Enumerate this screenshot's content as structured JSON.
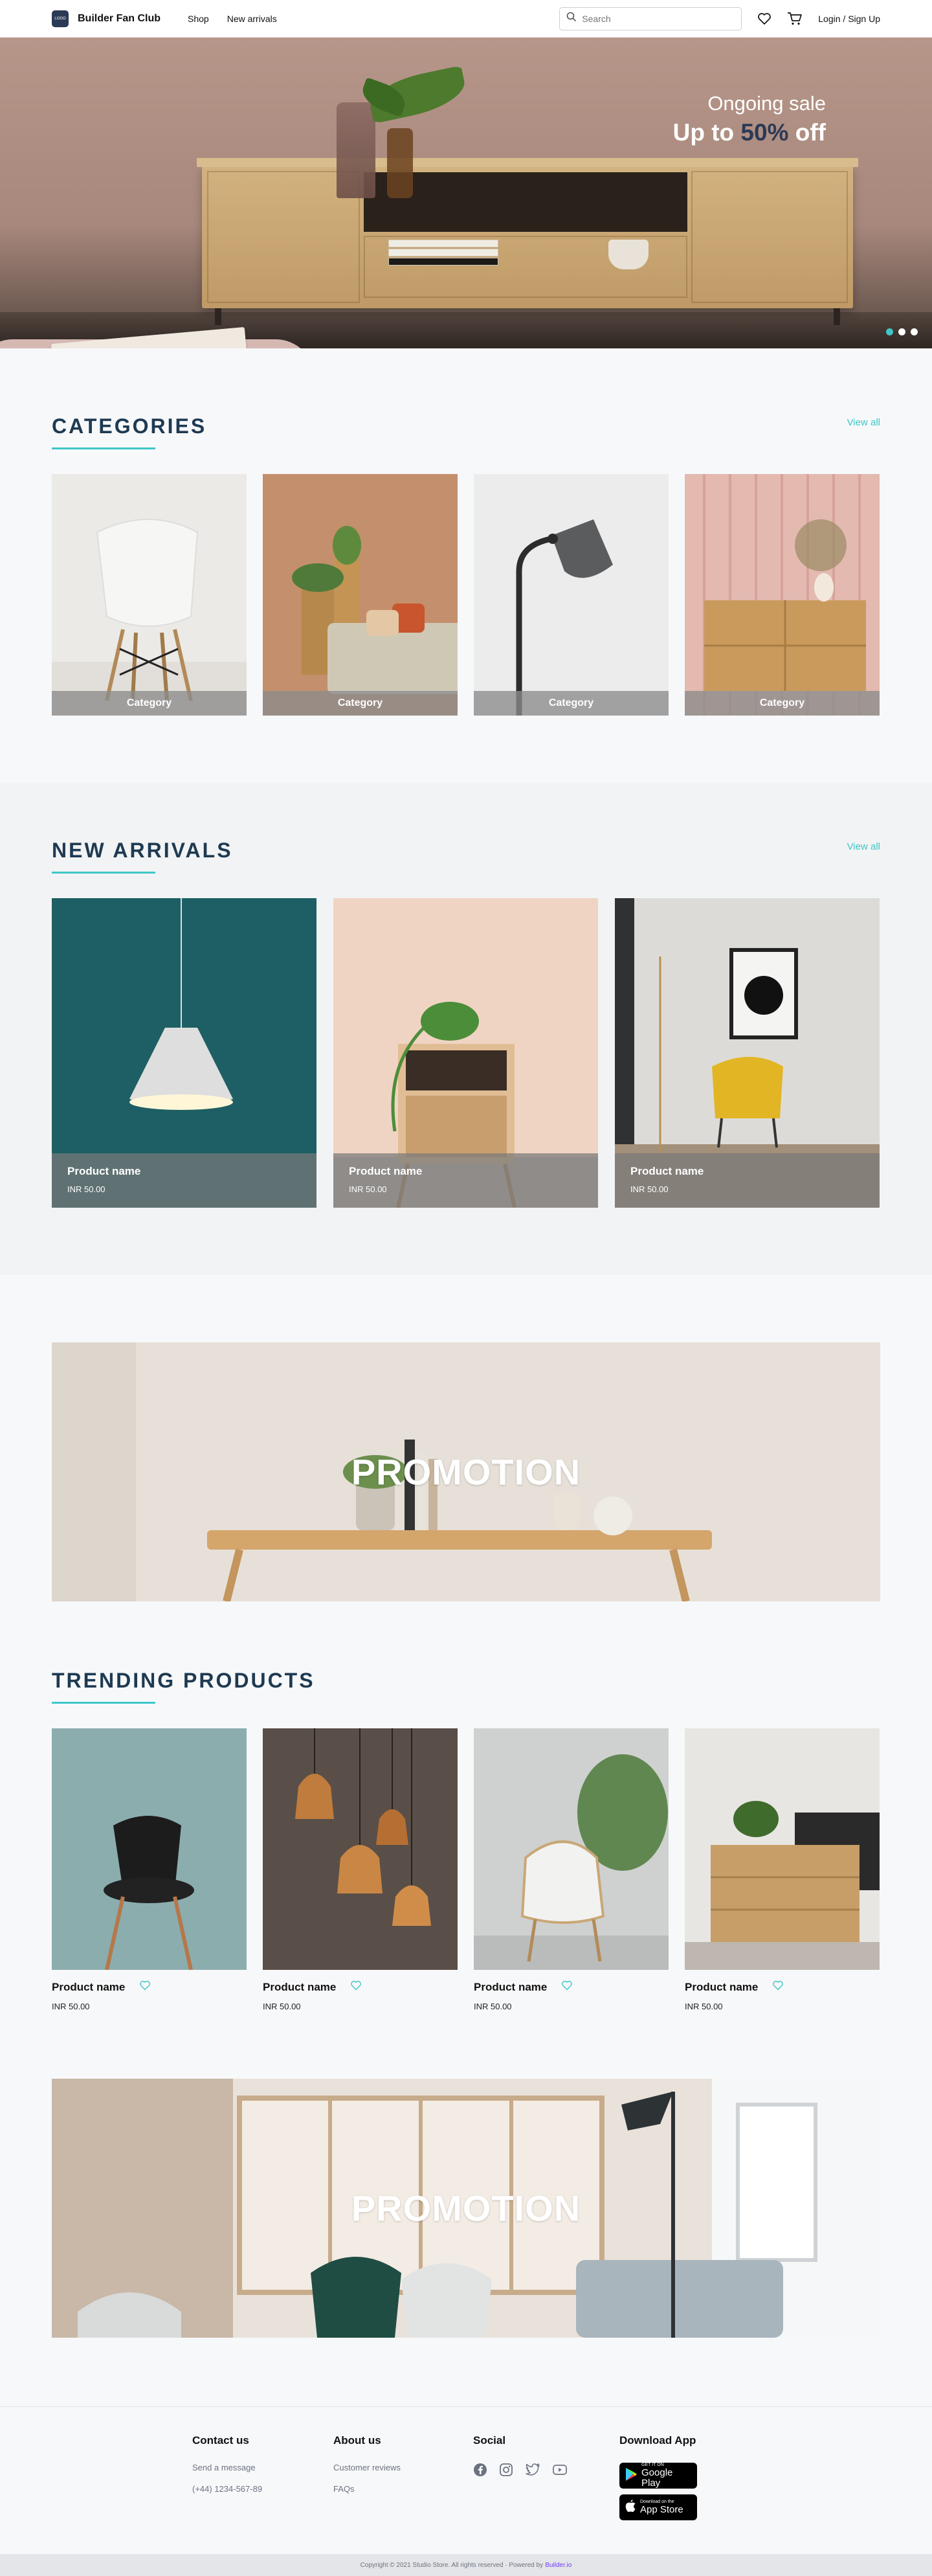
{
  "header": {
    "logo_text": "LOGO",
    "brand": "Builder Fan Club",
    "nav": [
      "Shop",
      "New arrivals"
    ],
    "search_placeholder": "Search",
    "login": "Login / Sign Up"
  },
  "hero": {
    "subtitle": "Ongoing sale",
    "title_prefix": "Up to",
    "title_percent": "50%",
    "title_suffix": "off",
    "dots": 3,
    "active_dot": 0
  },
  "categories": {
    "title": "CATEGORIES",
    "view_all": "View all",
    "items": [
      {
        "label": "Category"
      },
      {
        "label": "Category"
      },
      {
        "label": "Category"
      },
      {
        "label": "Category"
      }
    ]
  },
  "new_arrivals": {
    "title": "NEW ARRIVALS",
    "view_all": "View all",
    "items": [
      {
        "name": "Product name",
        "price": "INR 50.00"
      },
      {
        "name": "Product name",
        "price": "INR 50.00"
      },
      {
        "name": "Product name",
        "price": "INR 50.00"
      }
    ]
  },
  "promo1": {
    "text": "PROMOTION"
  },
  "trending": {
    "title": "TRENDING PRODUCTS",
    "items": [
      {
        "name": "Product name",
        "price": "INR 50.00"
      },
      {
        "name": "Product name",
        "price": "INR 50.00"
      },
      {
        "name": "Product name",
        "price": "INR 50.00"
      },
      {
        "name": "Product name",
        "price": "INR 50.00"
      }
    ]
  },
  "promo2": {
    "text": "PROMOTION"
  },
  "footer": {
    "contact": {
      "title": "Contact us",
      "links": [
        "Send a message",
        "(+44) 1234-567-89"
      ]
    },
    "about": {
      "title": "About us",
      "links": [
        "Customer reviews",
        "FAQs"
      ]
    },
    "social": {
      "title": "Social",
      "icons": [
        "facebook-icon",
        "instagram-icon",
        "twitter-icon",
        "youtube-icon"
      ]
    },
    "download": {
      "title": "Download App",
      "google": {
        "small": "GET IT ON",
        "big": "Google Play"
      },
      "apple": {
        "small": "Download on the",
        "big": "App Store"
      }
    },
    "copyright": "Copyright © 2021 Studio Store. All rights reserved · Powered by",
    "powered_by": "Builder.io"
  },
  "colors": {
    "accent": "#3ec7c7",
    "navy": "#2b3a55",
    "bg": "#f7f8fa"
  }
}
